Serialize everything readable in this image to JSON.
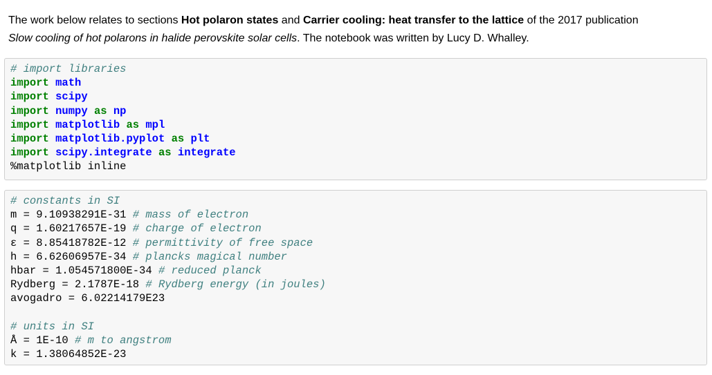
{
  "intro": {
    "prefix": "The work below relates to sections ",
    "section1": "Hot polaron states",
    "and": " and ",
    "section2": "Carrier cooling: heat transfer to the lattice",
    "of_the": " of the 2017 publication",
    "title": "Slow cooling of hot polarons in halide perovskite solar cells",
    "suffix": ". The notebook was written by Lucy D. Whalley."
  },
  "cell_imports": {
    "lines": [
      [
        {
          "t": "# import libraries",
          "c": "cm"
        }
      ],
      [
        {
          "t": "import",
          "c": "kw"
        },
        {
          "t": " ",
          "c": "pl"
        },
        {
          "t": "math",
          "c": "nn"
        }
      ],
      [
        {
          "t": "import",
          "c": "kw"
        },
        {
          "t": " ",
          "c": "pl"
        },
        {
          "t": "scipy",
          "c": "nn"
        }
      ],
      [
        {
          "t": "import",
          "c": "kw"
        },
        {
          "t": " ",
          "c": "pl"
        },
        {
          "t": "numpy",
          "c": "nn"
        },
        {
          "t": " ",
          "c": "pl"
        },
        {
          "t": "as",
          "c": "kw"
        },
        {
          "t": " ",
          "c": "pl"
        },
        {
          "t": "np",
          "c": "nn"
        }
      ],
      [
        {
          "t": "import",
          "c": "kw"
        },
        {
          "t": " ",
          "c": "pl"
        },
        {
          "t": "matplotlib",
          "c": "nn"
        },
        {
          "t": " ",
          "c": "pl"
        },
        {
          "t": "as",
          "c": "kw"
        },
        {
          "t": " ",
          "c": "pl"
        },
        {
          "t": "mpl",
          "c": "nn"
        }
      ],
      [
        {
          "t": "import",
          "c": "kw"
        },
        {
          "t": " ",
          "c": "pl"
        },
        {
          "t": "matplotlib.pyplot",
          "c": "nn"
        },
        {
          "t": " ",
          "c": "pl"
        },
        {
          "t": "as",
          "c": "kw"
        },
        {
          "t": " ",
          "c": "pl"
        },
        {
          "t": "plt",
          "c": "nn"
        }
      ],
      [
        {
          "t": "import",
          "c": "kw"
        },
        {
          "t": " ",
          "c": "pl"
        },
        {
          "t": "scipy.integrate",
          "c": "nn"
        },
        {
          "t": " ",
          "c": "pl"
        },
        {
          "t": "as",
          "c": "kw"
        },
        {
          "t": " ",
          "c": "pl"
        },
        {
          "t": "integrate",
          "c": "nn"
        }
      ],
      [
        {
          "t": "%matplotlib inline",
          "c": "mg"
        }
      ]
    ]
  },
  "cell_constants": {
    "lines": [
      [
        {
          "t": "# constants in SI",
          "c": "cm"
        }
      ],
      [
        {
          "t": "m = 9.10938291E-31 ",
          "c": "pl"
        },
        {
          "t": "# mass of electron",
          "c": "cm"
        }
      ],
      [
        {
          "t": "q = 1.60217657E-19 ",
          "c": "pl"
        },
        {
          "t": "# charge of electron",
          "c": "cm"
        }
      ],
      [
        {
          "t": "ε = 8.85418782E-12 ",
          "c": "pl"
        },
        {
          "t": "# permittivity of free space",
          "c": "cm"
        }
      ],
      [
        {
          "t": "h = 6.62606957E-34 ",
          "c": "pl"
        },
        {
          "t": "# plancks magical number",
          "c": "cm"
        }
      ],
      [
        {
          "t": "hbar = 1.054571800E-34 ",
          "c": "pl"
        },
        {
          "t": "# reduced planck",
          "c": "cm"
        }
      ],
      [
        {
          "t": "Rydberg = 2.1787E-18 ",
          "c": "pl"
        },
        {
          "t": "# Rydberg energy (in joules)",
          "c": "cm"
        }
      ],
      [
        {
          "t": "avogadro = 6.02214179E23",
          "c": "pl"
        }
      ],
      [
        {
          "t": "",
          "c": "pl"
        }
      ],
      [
        {
          "t": "# units in SI",
          "c": "cm"
        }
      ],
      [
        {
          "t": "Å = 1E-10 ",
          "c": "pl"
        },
        {
          "t": "# m to angstrom",
          "c": "cm"
        }
      ],
      [
        {
          "t": "k = 1.38064852E-23",
          "c": "pl"
        }
      ]
    ]
  },
  "colors": {
    "keyword": "#008000",
    "name": "#0000ff",
    "comment": "#408080",
    "cell_bg": "#f7f7f7",
    "cell_border": "#cfcfcf"
  }
}
